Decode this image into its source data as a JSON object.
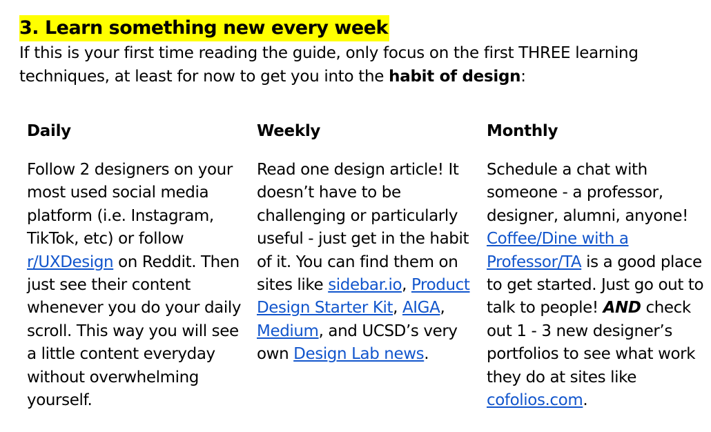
{
  "heading": "3. Learn something new every week",
  "intro": {
    "text_before": "If this is your first time reading the guide, only focus on the first THREE learning techniques, at least for now to get you into the ",
    "bold": "habit of design",
    "text_after": ":"
  },
  "highlight_color": "#ffff00",
  "link_color": "#1155cc",
  "columns": {
    "daily": {
      "title": "Daily",
      "text_1": "Follow 2 designers on your most used social media platform (i.e. Instagram, TikTok, etc) or follow ",
      "link_1": "r/UXDesign",
      "text_2": " on Reddit. Then just see their content whenever you do your daily scroll. This way you will see a little content everyday without overwhelming yourself."
    },
    "weekly": {
      "title": "Weekly",
      "text_1": "Read one design article! It doesn’t have to be challenging or particularly useful - just get in the habit of it. You can find them on sites like ",
      "link_1": "sidebar.io",
      "sep_1": ", ",
      "link_2": "Product Design Starter Kit",
      "sep_2": ", ",
      "link_3": "AIGA",
      "sep_3": ", ",
      "link_4": "Medium",
      "text_2": ", and UCSD’s very own ",
      "link_5": "Design Lab news",
      "text_3": "."
    },
    "monthly": {
      "title": "Monthly",
      "text_1": "Schedule a chat with someone - a professor, designer, alumni, anyone! ",
      "link_1": "Coffee/Dine with a Professor/TA",
      "text_2": " is a good place to get started. Just go out to talk to people! ",
      "emphasis": "AND",
      "text_3": " check out 1 - 3 new designer’s portfolios to see what work they do at sites like ",
      "link_2": "cofolios.com",
      "text_4": "."
    }
  }
}
